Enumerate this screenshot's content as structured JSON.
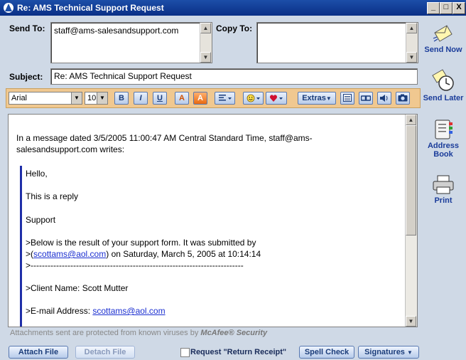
{
  "window": {
    "title": "Re: AMS Technical Support Request",
    "controls": [
      "_",
      "□",
      "X"
    ]
  },
  "send_to": {
    "label": "Send To:",
    "value": "staff@ams-salesandsupport.com"
  },
  "copy_to": {
    "label": "Copy To:",
    "value": ""
  },
  "subject": {
    "label": "Subject:",
    "value": "Re: AMS Technical Support Request"
  },
  "toolbar": {
    "font": "Arial",
    "size": "10",
    "bold": "B",
    "italic": "I",
    "underline": "U",
    "extras": "Extras"
  },
  "message": {
    "intro_line1": "In a message dated 3/5/2005 11:00:47 AM Central Standard Time, staff@ams-",
    "intro_line2": "salesandsupport.com writes:",
    "hello": "Hello,",
    "reply": "This is a reply",
    "support": "Support",
    "form_line1": ">Below is the result of your support form.  It was submitted by",
    "form_prefix": ">(",
    "form_email": "scottams@aol.com",
    "form_suffix": ") on Saturday, March 5, 2005 at 10:14:14",
    "separator": ">---------------------------------------------------------------------------",
    "client": ">Client Name: Scott Mutter",
    "email_prefix": ">E-mail Address: ",
    "email_value": "scottams@aol.com"
  },
  "footer": {
    "antivirus_text": "Attachments sent are protected from known viruses by ",
    "antivirus_brand": "McAfee® Security",
    "attach": "Attach File",
    "detach": "Detach File",
    "receipt": "Request \"Return Receipt\"",
    "spell": "Spell Check",
    "signatures": "Signatures"
  },
  "sidebar": {
    "send_now": "Send Now",
    "send_later": "Send Later",
    "address_book_1": "Address",
    "address_book_2": "Book",
    "print": "Print"
  }
}
